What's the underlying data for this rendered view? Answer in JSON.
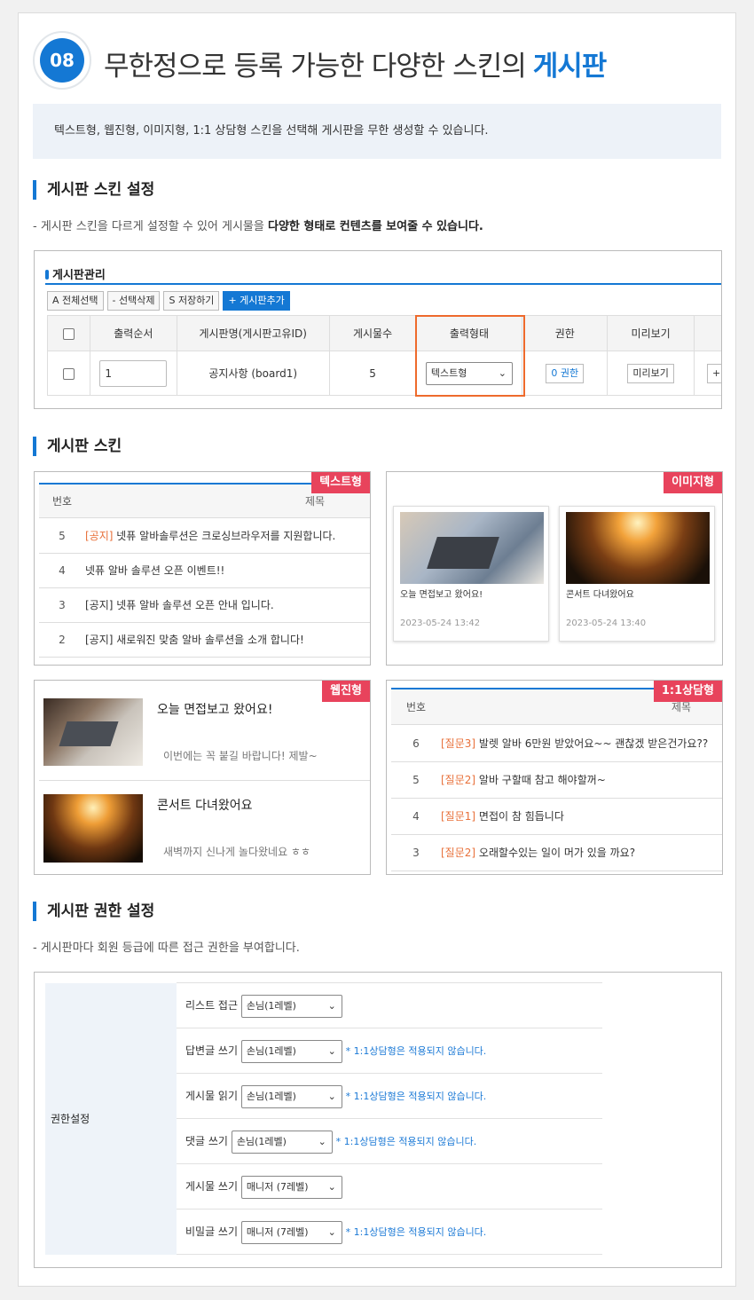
{
  "header": {
    "badge": "08",
    "title": "무한정으로 등록 가능한 다양한 스킨의",
    "title_highlight": "게시판",
    "info": "텍스트형, 웹진형, 이미지형, 1:1 상담형 스킨을 선택해 게시판을 무한 생성할 수 있습니다."
  },
  "colors": {
    "accent": "#1478d4",
    "tag": "#e8435c",
    "highlight_border": "#ee6a2c",
    "orange_text": "#e8703a"
  },
  "section1": {
    "title": "게시판 스킨 설정",
    "desc_prefix": "- 게시판 스킨을 다르게 설정할 수 있어 게시물을 ",
    "desc_bold": "다양한 형태로 컨텐츠를 보여줄 수 있습니다."
  },
  "admin": {
    "title": "게시판관리",
    "buttons": {
      "select_all": "A 전체선택",
      "delete_sel": "- 선택삭제",
      "save": "S 저장하기",
      "add": "+ 게시판추가"
    },
    "columns": [
      "출력순서",
      "게시판명(게시판고유ID)",
      "게시물수",
      "출력형태",
      "권한",
      "미리보기"
    ],
    "row": {
      "order": "1",
      "name": "공지사항 (board1)",
      "count": "5",
      "type": "텍스트형",
      "perm": "0 권한",
      "preview": "미리보기",
      "extra": "+"
    }
  },
  "section2": {
    "title": "게시판 스킨"
  },
  "text_skin": {
    "tag": "텍스트형",
    "col_no": "번호",
    "col_title": "제목",
    "rows": [
      {
        "no": "5",
        "prefix": "[공지]",
        "title": " 넷퓨 알바솔루션은 크로싱브라우저를 지원합니다."
      },
      {
        "no": "4",
        "prefix": "",
        "title": "넷퓨 알바 솔루션 오픈 이벤트!!"
      },
      {
        "no": "3",
        "prefix": "",
        "title": "[공지] 넷퓨 알바 솔루션 오픈 안내 입니다."
      },
      {
        "no": "2",
        "prefix": "",
        "title": "[공지] 새로워진 맞춤 알바 솔루션을 소개 합니다!"
      }
    ]
  },
  "image_skin": {
    "tag": "이미지형",
    "cards": [
      {
        "title": "오늘 면접보고 왔어요!",
        "date": "2023-05-24 13:42"
      },
      {
        "title": "콘서트 다녀왔어요",
        "date": "2023-05-24 13:40"
      }
    ]
  },
  "webzine_skin": {
    "tag": "웹진형",
    "items": [
      {
        "title": "오늘 면접보고 왔어요!",
        "summary": "이번에는 꼭 붙길 바랍니다! 제발~"
      },
      {
        "title": "콘서트 다녀왔어요",
        "summary": "새벽까지 신나게 놀다왔네요 ㅎㅎ"
      }
    ]
  },
  "qa_skin": {
    "tag": "1:1상담형",
    "col_no": "번호",
    "col_title": "제목",
    "rows": [
      {
        "no": "6",
        "prefix": "[질문3]",
        "title": " 발렛 알바 6만원 받았어요~~ 괜찮겠 받은건가요??"
      },
      {
        "no": "5",
        "prefix": "[질문2]",
        "title": " 알바 구할때 참고 해야할꺼~"
      },
      {
        "no": "4",
        "prefix": "[질문1]",
        "title": " 면접이 참 힘듭니다"
      },
      {
        "no": "3",
        "prefix": "[질문2]",
        "title": " 오래할수있는 일이 머가 있을 까요?"
      }
    ]
  },
  "section3": {
    "title": "게시판 권한 설정",
    "desc": "- 게시판마다 회원 등급에 따른 접근 권한을 부여합니다."
  },
  "perm": {
    "side_label": "권한설정",
    "rows": [
      {
        "label": "리스트 접근",
        "value": "손님(1레벨)",
        "note": ""
      },
      {
        "label": "답변글 쓰기",
        "value": "손님(1레벨)",
        "note": "* 1:1상담형은 적용되지 않습니다."
      },
      {
        "label": "게시물 읽기",
        "value": "손님(1레벨)",
        "note": "* 1:1상담형은 적용되지 않습니다."
      },
      {
        "label": "댓글 쓰기",
        "value": "손님(1레벨)",
        "note": "* 1:1상담형은 적용되지 않습니다."
      },
      {
        "label": "게시물 쓰기",
        "value": "매니저 (7레벨)",
        "note": ""
      },
      {
        "label": "비밀글 쓰기",
        "value": "매니저 (7레벨)",
        "note": "* 1:1상담형은 적용되지 않습니다."
      }
    ]
  }
}
